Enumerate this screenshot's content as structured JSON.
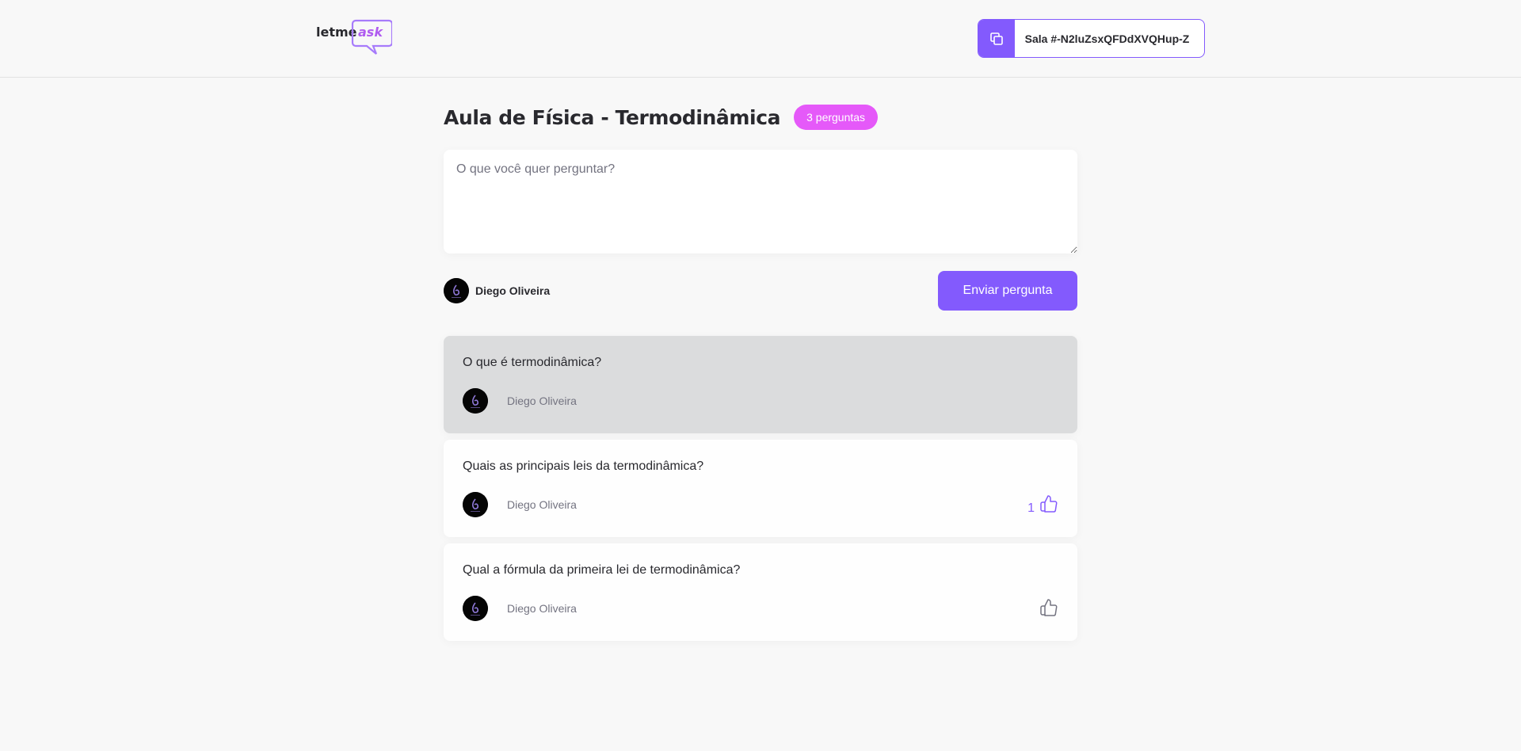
{
  "header": {
    "logo": {
      "text_main": "letme",
      "text_accent": "ask"
    },
    "room_code": {
      "label": "Sala #-N2luZsxQFDdXVQHup-Z",
      "icon": "copy-icon"
    }
  },
  "page": {
    "title": "Aula de Física - Termodinâmica",
    "question_count_badge": "3 perguntas"
  },
  "form": {
    "placeholder": "O que você quer perguntar?",
    "value": "",
    "user_name": "Diego Oliveira",
    "submit_label": "Enviar pergunta"
  },
  "questions": [
    {
      "content": "O que é termodinâmica?",
      "author": "Diego Oliveira",
      "highlighted": true,
      "like_count": "",
      "liked": false,
      "show_like": false
    },
    {
      "content": "Quais as principais leis da termodinâmica?",
      "author": "Diego Oliveira",
      "highlighted": false,
      "like_count": "1",
      "liked": true,
      "show_like": true
    },
    {
      "content": "Qual a fórmula da primeira lei de termodinâmica?",
      "author": "Diego Oliveira",
      "highlighted": false,
      "like_count": "",
      "liked": false,
      "show_like": true
    }
  ],
  "colors": {
    "accent": "#835afd",
    "badge": "#e559f9",
    "highlight_bg": "#dbdcdd",
    "text_muted": "#737380"
  }
}
